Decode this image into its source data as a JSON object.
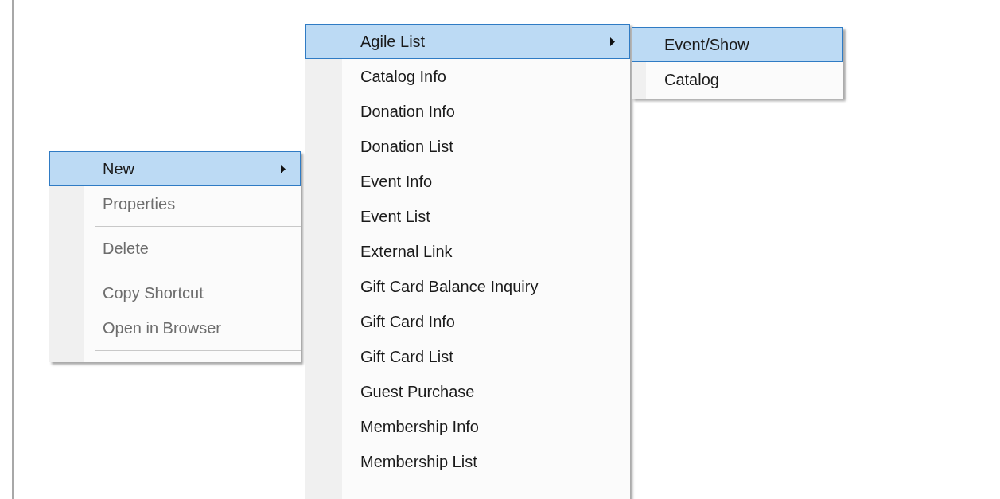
{
  "context_menu": {
    "items": [
      {
        "kind": "item",
        "label": "New",
        "selected": true,
        "disabled": false,
        "submenu": true
      },
      {
        "kind": "item",
        "label": "Properties",
        "selected": false,
        "disabled": true,
        "submenu": false
      },
      {
        "kind": "separator"
      },
      {
        "kind": "item",
        "label": "Delete",
        "selected": false,
        "disabled": true,
        "submenu": false
      },
      {
        "kind": "separator"
      },
      {
        "kind": "item",
        "label": "Copy Shortcut",
        "selected": false,
        "disabled": true,
        "submenu": false
      },
      {
        "kind": "item",
        "label": "Open in Browser",
        "selected": false,
        "disabled": true,
        "submenu": false
      },
      {
        "kind": "separator"
      }
    ]
  },
  "new_submenu": {
    "items": [
      {
        "kind": "item",
        "label": "Agile List",
        "selected": true,
        "disabled": false,
        "submenu": true
      },
      {
        "kind": "item",
        "label": "Catalog Info",
        "selected": false,
        "disabled": false,
        "submenu": false
      },
      {
        "kind": "item",
        "label": "Donation Info",
        "selected": false,
        "disabled": false,
        "submenu": false
      },
      {
        "kind": "item",
        "label": "Donation List",
        "selected": false,
        "disabled": false,
        "submenu": false
      },
      {
        "kind": "item",
        "label": "Event Info",
        "selected": false,
        "disabled": false,
        "submenu": false
      },
      {
        "kind": "item",
        "label": "Event List",
        "selected": false,
        "disabled": false,
        "submenu": false
      },
      {
        "kind": "item",
        "label": "External Link",
        "selected": false,
        "disabled": false,
        "submenu": false
      },
      {
        "kind": "item",
        "label": "Gift Card Balance Inquiry",
        "selected": false,
        "disabled": false,
        "submenu": false
      },
      {
        "kind": "item",
        "label": "Gift Card Info",
        "selected": false,
        "disabled": false,
        "submenu": false
      },
      {
        "kind": "item",
        "label": "Gift Card List",
        "selected": false,
        "disabled": false,
        "submenu": false
      },
      {
        "kind": "item",
        "label": "Guest Purchase",
        "selected": false,
        "disabled": false,
        "submenu": false
      },
      {
        "kind": "item",
        "label": "Membership Info",
        "selected": false,
        "disabled": false,
        "submenu": false
      },
      {
        "kind": "item",
        "label": "Membership List",
        "selected": false,
        "disabled": false,
        "submenu": false
      }
    ]
  },
  "agile_list_submenu": {
    "items": [
      {
        "kind": "item",
        "label": "Event/Show",
        "selected": true,
        "disabled": false,
        "submenu": false
      },
      {
        "kind": "item",
        "label": "Catalog",
        "selected": false,
        "disabled": false,
        "submenu": false
      }
    ]
  }
}
